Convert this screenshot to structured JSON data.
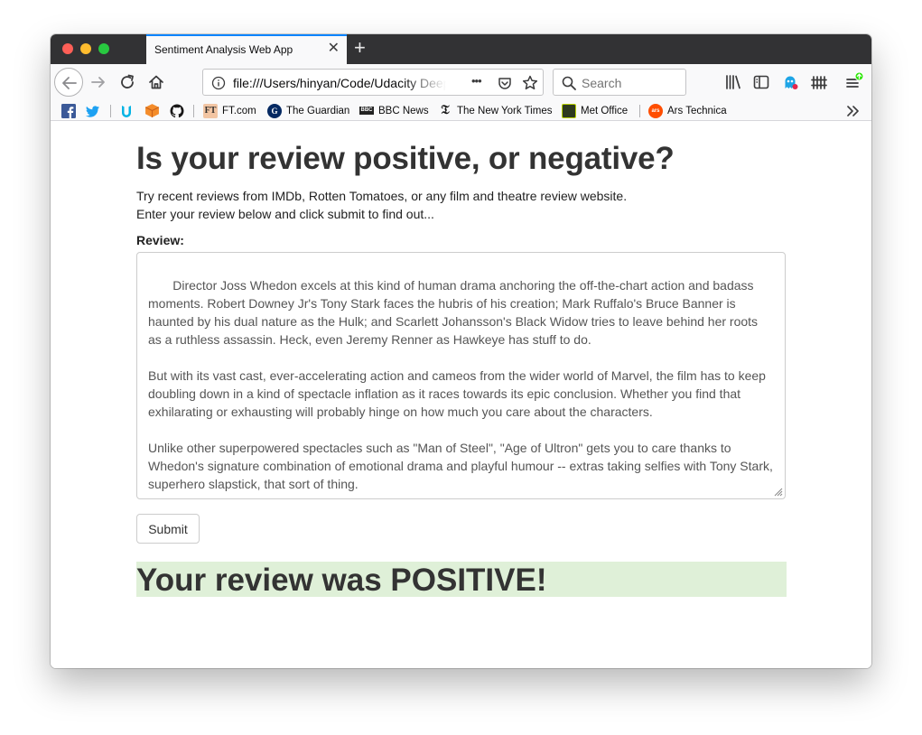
{
  "browser": {
    "tab_title": "Sentiment Analysis Web App",
    "url": "file:///Users/hinyan/Code/Udacity Deep Learning/sagemaker-deployment/Project/website/index.html",
    "search_placeholder": "Search",
    "url_more": "•••"
  },
  "bookmarks": [
    {
      "label": "FT.com",
      "icon": "ft-icon"
    },
    {
      "label": "The Guardian",
      "icon": "guardian-icon"
    },
    {
      "label": "BBC News",
      "icon": "bbc-icon"
    },
    {
      "label": "The New York Times",
      "icon": "nyt-icon"
    },
    {
      "label": "Met Office",
      "icon": "met-office-icon"
    },
    {
      "label": "Ars Technica",
      "icon": "ars-technica-icon"
    }
  ],
  "page": {
    "heading": "Is your review positive, or negative?",
    "intro_line1": "Try recent reviews from IMDb, Rotten Tomatoes, or any film and theatre review website.",
    "intro_line2": "Enter your review below and click submit to find out...",
    "review_label": "Review:",
    "review_text": " Director Joss Whedon excels at this kind of human drama anchoring the off-the-chart action and badass moments. Robert Downey Jr's Tony Stark faces the hubris of his creation; Mark Ruffalo's Bruce Banner is haunted by his dual nature as the Hulk; and Scarlett Johansson's Black Widow tries to leave behind her roots as a ruthless assassin. Heck, even Jeremy Renner as Hawkeye has stuff to do.\n\nBut with its vast cast, ever-accelerating action and cameos from the wider world of Marvel, the film has to keep doubling down in a kind of spectacle inflation as it races towards its epic conclusion. Whether you find that exhilarating or exhausting will probably hinge on how much you care about the characters.\n\nUnlike other superpowered spectacles such as \"Man of Steel\", \"Age of Ultron\" gets you to care thanks to Whedon's signature combination of emotional drama and playful humour -- extras taking selfies with Tony Stark, superhero slapstick, that sort of thing.",
    "submit_label": "Submit",
    "result": "Your review was POSITIVE!"
  },
  "colors": {
    "result_bg": "#dff0d8",
    "tab_accent": "#0a84ff"
  }
}
